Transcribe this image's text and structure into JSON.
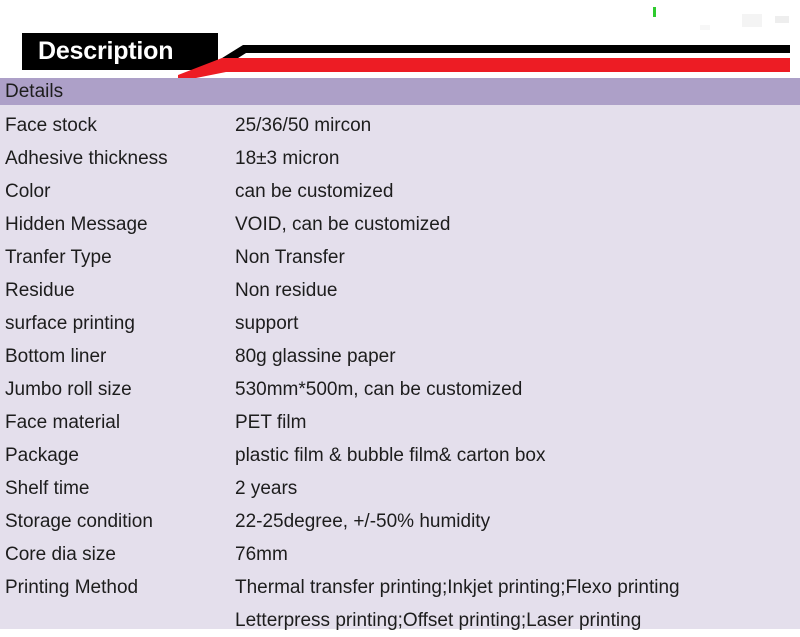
{
  "banner": {
    "title": "Description",
    "accent_black": "#000000",
    "accent_red": "#ed1c24",
    "background": "#ffffff"
  },
  "table": {
    "header_label": "Details",
    "header_bg": "#ada0c8",
    "body_bg": "#e4dfec",
    "text_color": "#1d1d1d",
    "rows": [
      {
        "label": "Face stock",
        "value": "25/36/50 mircon"
      },
      {
        "label": "Adhesive thickness",
        "value": "18±3 micron"
      },
      {
        "label": "Color",
        "value": "can be customized"
      },
      {
        "label": "Hidden Message",
        "value": "VOID, can be customized"
      },
      {
        "label": "Tranfer Type",
        "value": "Non Transfer"
      },
      {
        "label": "Residue",
        "value": "Non residue"
      },
      {
        "label": "surface printing",
        "value": "support"
      },
      {
        "label": "Bottom liner",
        "value": "80g glassine paper"
      },
      {
        "label": "Jumbo roll size",
        "value": "530mm*500m, can be customized"
      },
      {
        "label": "Face material",
        "value": "PET film"
      },
      {
        "label": "Package",
        "value": "plastic film & bubble film& carton box"
      },
      {
        "label": "Shelf time",
        "value": "2 years"
      },
      {
        "label": "Storage condition",
        "value": "22-25degree, +/-50% humidity"
      },
      {
        "label": "Core dia size",
        "value": "76mm"
      }
    ],
    "last_row": {
      "label": "Printing Method",
      "value_line1": "Thermal transfer printing;Inkjet printing;Flexo printing",
      "value_line2": "Letterpress printing;Offset printing;Laser printing"
    }
  }
}
